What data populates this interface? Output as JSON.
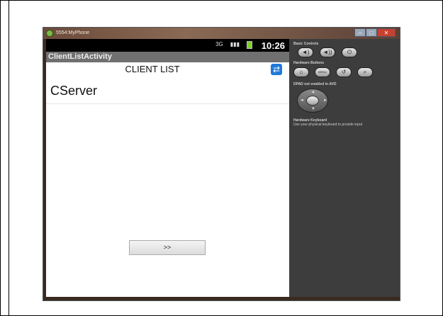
{
  "window": {
    "title": "5554:MyPhone",
    "controls": [
      "–",
      "□",
      "✕"
    ]
  },
  "statusbar": {
    "network_label": "3G",
    "time": "10:26"
  },
  "app": {
    "activity_title": "ClientListActivity",
    "list_title": "CLIENT LIST",
    "refresh_icon": "refresh-icon",
    "clients": [
      "CServer"
    ],
    "next_button_label": ">>"
  },
  "panel": {
    "basic_controls_label": "Basic Controls",
    "hardware_buttons_label": "Hardware Buttons",
    "menu_label": "MENU",
    "dpad_label": "DPAD not enabled in AVD",
    "keyboard_title": "Hardware Keyboard",
    "keyboard_hint": "Use your physical keyboard to provide input"
  },
  "colors": {
    "statusbar": "#000000",
    "actionbar": "#707070",
    "refresh": "#1f7ad8",
    "panel": "#3d3d3d"
  }
}
